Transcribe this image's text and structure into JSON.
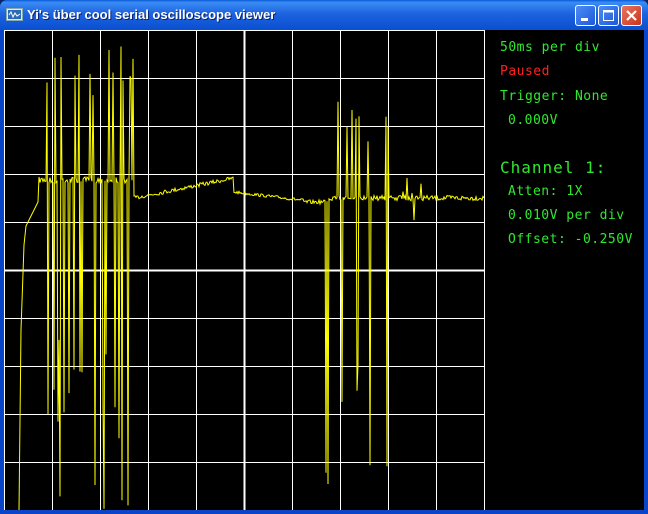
{
  "window": {
    "title": "Yi's über cool serial oscilloscope viewer"
  },
  "titlebar_buttons": [
    "minimize",
    "maximize",
    "close"
  ],
  "status": {
    "timebase": "50ms per div",
    "state": "Paused",
    "trigger": "Trigger: None",
    "trigger_level": "0.000V"
  },
  "channel": {
    "title": "Channel 1:",
    "atten": "Atten: 1X",
    "scale": "0.010V per div",
    "offset": "Offset: -0.250V"
  },
  "colors": {
    "trace": "#ffff00",
    "grid": "#ffffff",
    "info_text": "#30e830",
    "paused_text": "#ff2020",
    "background": "#000000"
  },
  "icons": [
    "app-icon",
    "minimize-icon",
    "maximize-icon",
    "close-icon"
  ]
}
